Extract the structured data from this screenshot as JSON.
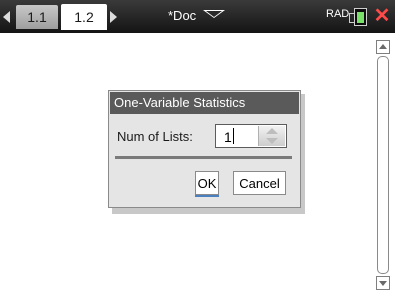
{
  "tabs": [
    {
      "label": "1.1",
      "active": false
    },
    {
      "label": "1.2",
      "active": true
    }
  ],
  "document": {
    "title": "*Doc"
  },
  "status": {
    "angle_mode": "RAD",
    "close": "✕"
  },
  "colors": {
    "titlebar": "#1a1a1a",
    "close": "#ff4a4a",
    "battery": "#7be06a",
    "dialog_title": "#5a5a5a"
  },
  "dialog": {
    "title": "One-Variable Statistics",
    "field_label": "Num of Lists:",
    "field_value": "1",
    "ok_label": "OK",
    "cancel_label": "Cancel"
  }
}
